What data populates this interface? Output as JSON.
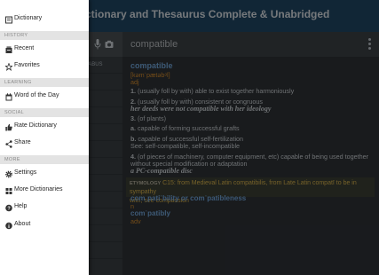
{
  "app": {
    "title": "ctionary and Thesaurus Complete & Unabridged",
    "search_value": "compatible",
    "wordlist_visible_label": "TABUS"
  },
  "article": {
    "headword": "compatible",
    "pronunciation": "[kəmˈpætəbᵊl]",
    "pos": "adj",
    "senses": [
      {
        "num": "1.",
        "text": "(usually foll by with) able to exist together harmoniously"
      },
      {
        "num": "2.",
        "text": "(usually foll by with) consistent or congruous"
      },
      {
        "example": "her deeds were not compatible with her ideology"
      },
      {
        "num": "3.",
        "text": "(of plants)"
      },
      {
        "num": "a.",
        "text": "capable of forming successful grafts"
      },
      {
        "num": "b.",
        "text": "capable of successful self-fertilization"
      },
      {
        "see": "See: self-compatible, self-incompatible"
      },
      {
        "num": "4.",
        "text": "(of pieces of machinery, computer equipment, etc) capable of being used together"
      },
      {
        "text": "without special modification or adaptation"
      },
      {
        "example": "a PC-compatible disc"
      }
    ],
    "etymology_tag": "ETYMOLOGY",
    "etymology_line1": "C15: from Medieval Latin compatibilis, from Late Latin compatī to be in sympathy",
    "etymology_line2": "with; see compassion",
    "derived1": "comˌpatiˈbility or comˈpatibleness",
    "derived1_pos": "n",
    "derived2": "comˈpatibly",
    "derived2_pos": "adv"
  },
  "drawer": {
    "items": [
      {
        "label": "Dictionary",
        "icon": "dictionary-icon"
      },
      {
        "header": "HISTORY"
      },
      {
        "label": "Recent",
        "icon": "recent-icon"
      },
      {
        "label": "Favorites",
        "icon": "star-icon"
      },
      {
        "header": "LEARNING"
      },
      {
        "label": "Word of the Day",
        "icon": "calendar-icon"
      },
      {
        "header": "SOCIAL"
      },
      {
        "label": "Rate Dictionary",
        "icon": "thumbs-up-icon"
      },
      {
        "label": "Share",
        "icon": "share-icon"
      },
      {
        "header": "MORE"
      },
      {
        "label": "Settings",
        "icon": "gear-icon"
      },
      {
        "label": "More Dictionaries",
        "icon": "apps-icon"
      },
      {
        "label": "Help",
        "icon": "help-icon"
      },
      {
        "label": "About",
        "icon": "info-icon"
      }
    ]
  },
  "colors": {
    "titlebar": "#1f4563",
    "headword": "#6fa3d6",
    "pronunciation": "#d28a2c",
    "etymology": "#d8b24c",
    "drawer": "#ffffff"
  }
}
